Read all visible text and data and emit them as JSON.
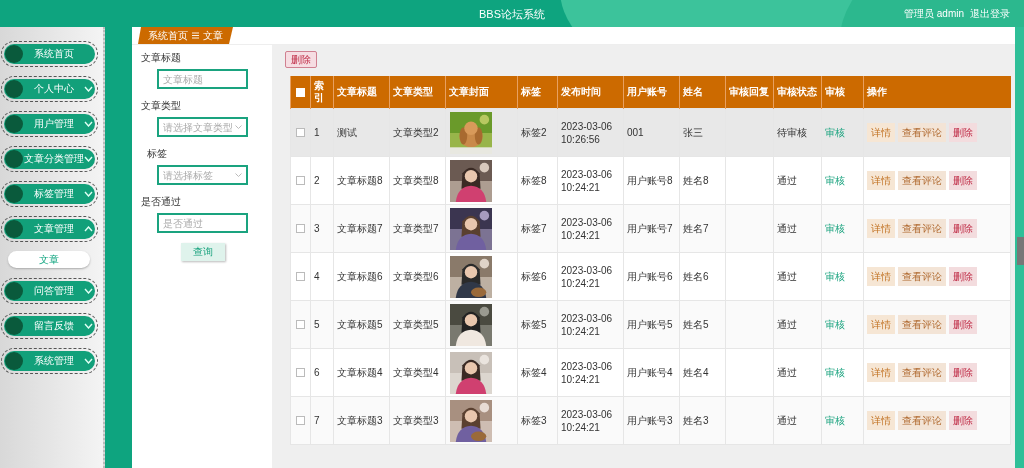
{
  "header": {
    "title": "BBS论坛系统",
    "user": "管理员 admin",
    "logout": "退出登录"
  },
  "sidebar": {
    "items": [
      {
        "label": "系统首页",
        "kind": "link"
      },
      {
        "label": "个人中心",
        "kind": "group",
        "expanded": false
      },
      {
        "label": "用户管理",
        "kind": "group",
        "expanded": false
      },
      {
        "label": "文章分类管理",
        "kind": "group",
        "expanded": false
      },
      {
        "label": "标签管理",
        "kind": "group",
        "expanded": false
      },
      {
        "label": "文章管理",
        "kind": "group",
        "expanded": true,
        "children": [
          {
            "label": "文章",
            "selected": true
          }
        ]
      },
      {
        "label": "问答管理",
        "kind": "group",
        "expanded": false
      },
      {
        "label": "留言反馈",
        "kind": "group",
        "expanded": false
      },
      {
        "label": "系统管理",
        "kind": "group",
        "expanded": false
      }
    ]
  },
  "breadcrumb": [
    "系统首页",
    "文章"
  ],
  "search": {
    "fields": [
      {
        "label": "文章标题",
        "placeholder": "文章标题",
        "kind": "text"
      },
      {
        "label": "文章类型",
        "placeholder": "请选择文章类型",
        "kind": "select"
      },
      {
        "label": "标签",
        "placeholder": "请选择标签",
        "kind": "select"
      },
      {
        "label": "是否通过",
        "placeholder": "是否通过",
        "kind": "text"
      }
    ],
    "button": "查询"
  },
  "toolbar": {
    "delete": "删除"
  },
  "table": {
    "header_checked": false,
    "columns": [
      "索引",
      "文章标题",
      "文章类型",
      "文章封面",
      "标签",
      "发布时间",
      "用户账号",
      "姓名",
      "审核回复",
      "审核状态",
      "审核",
      "操作"
    ],
    "rows": [
      {
        "selected": true,
        "checked": false,
        "index": "1",
        "title": "测试",
        "type": "文章类型2",
        "cover": {
          "kind": "picture"
        },
        "tag": "标签2",
        "time": "2023-03-06 10:26:56",
        "account": "001",
        "name": "张三",
        "status": "待审核",
        "audit": "审核",
        "actions": [
          "详情",
          "查看评论",
          "删除"
        ]
      },
      {
        "selected": false,
        "checked": false,
        "index": "2",
        "title": "文章标题8",
        "type": "文章类型8",
        "cover": {
          "kind": "picture"
        },
        "tag": "标签8",
        "time": "2023-03-06 10:24:21",
        "account": "用户账号8",
        "name": "姓名8",
        "status": "通过",
        "audit": "审核",
        "actions": [
          "详情",
          "查看评论",
          "删除"
        ]
      },
      {
        "selected": false,
        "checked": false,
        "index": "3",
        "title": "文章标题7",
        "type": "文章类型7",
        "cover": {
          "kind": "picture"
        },
        "tag": "标签7",
        "time": "2023-03-06 10:24:21",
        "account": "用户账号7",
        "name": "姓名7",
        "status": "通过",
        "audit": "审核",
        "actions": [
          "详情",
          "查看评论",
          "删除"
        ]
      },
      {
        "selected": false,
        "checked": false,
        "index": "4",
        "title": "文章标题6",
        "type": "文章类型6",
        "cover": {
          "kind": "picture"
        },
        "tag": "标签6",
        "time": "2023-03-06 10:24:21",
        "account": "用户账号6",
        "name": "姓名6",
        "status": "通过",
        "audit": "审核",
        "actions": [
          "详情",
          "查看评论",
          "删除"
        ]
      },
      {
        "selected": false,
        "checked": false,
        "index": "5",
        "title": "文章标题5",
        "type": "文章类型5",
        "cover": {
          "kind": "picture"
        },
        "tag": "标签5",
        "time": "2023-03-06 10:24:21",
        "account": "用户账号5",
        "name": "姓名5",
        "status": "通过",
        "audit": "审核",
        "actions": [
          "详情",
          "查看评论",
          "删除"
        ]
      },
      {
        "selected": false,
        "checked": false,
        "index": "6",
        "title": "文章标题4",
        "type": "文章类型4",
        "cover": {
          "kind": "picture"
        },
        "tag": "标签4",
        "time": "2023-03-06 10:24:21",
        "account": "用户账号4",
        "name": "姓名4",
        "status": "通过",
        "audit": "审核",
        "actions": [
          "详情",
          "查看评论",
          "删除"
        ]
      },
      {
        "selected": false,
        "checked": false,
        "index": "7",
        "title": "文章标题3",
        "type": "文章类型3",
        "cover": {
          "kind": "picture"
        },
        "tag": "标签3",
        "time": "2023-03-06 10:24:21",
        "account": "用户账号3",
        "name": "姓名3",
        "status": "通过",
        "audit": "审核",
        "actions": [
          "详情",
          "查看评论",
          "删除"
        ]
      }
    ]
  }
}
